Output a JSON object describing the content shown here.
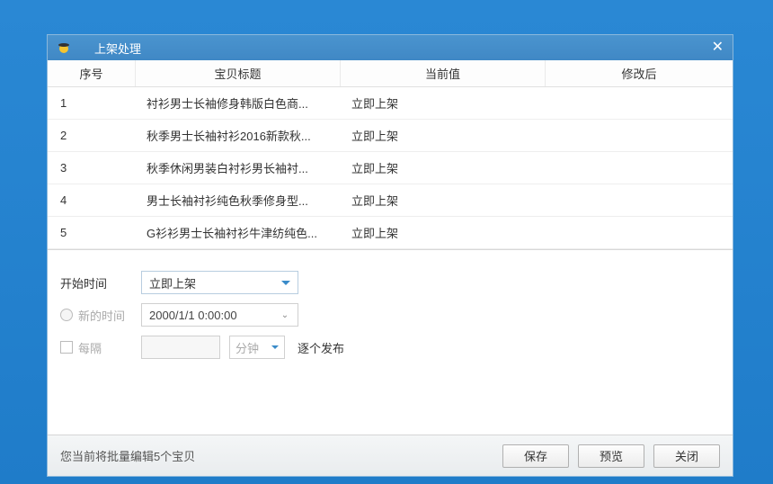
{
  "window": {
    "title": "上架处理"
  },
  "table": {
    "headers": {
      "seq": "序号",
      "title": "宝贝标题",
      "current": "当前值",
      "after": "修改后"
    },
    "rows": [
      {
        "seq": "1",
        "title": "衬衫男士长袖修身韩版白色商...",
        "current": "立即上架",
        "after": ""
      },
      {
        "seq": "2",
        "title": "秋季男士长袖衬衫2016新款秋...",
        "current": "立即上架",
        "after": ""
      },
      {
        "seq": "3",
        "title": "秋季休闲男装白衬衫男长袖衬...",
        "current": "立即上架",
        "after": ""
      },
      {
        "seq": "4",
        "title": "男士长袖衬衫纯色秋季修身型...",
        "current": "立即上架",
        "after": ""
      },
      {
        "seq": "5",
        "title": "G衫衫男士长袖衬衫牛津纺纯色...",
        "current": "立即上架",
        "after": ""
      }
    ]
  },
  "form": {
    "start_time_label": "开始时间",
    "start_time_value": "立即上架",
    "new_time_label": "新的时间",
    "date_value": "2000/1/1  0:00:00",
    "interval_label": "每隔",
    "interval_value": "",
    "unit_label": "分钟",
    "release_text": "逐个发布"
  },
  "footer": {
    "status": "您当前将批量编辑5个宝贝",
    "buttons": {
      "save": "保存",
      "preview": "预览",
      "close": "关闭"
    }
  }
}
